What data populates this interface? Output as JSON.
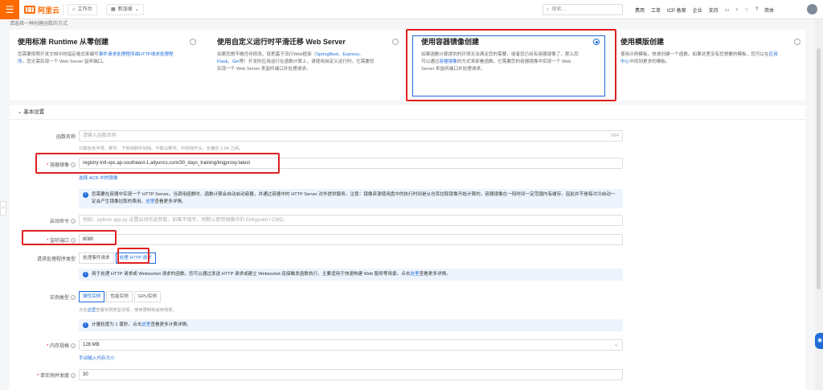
{
  "topbar": {
    "menu_icon": "menu-icon",
    "logo_text": "阿里云",
    "workbench": "工作台",
    "region": "新加坡",
    "search_placeholder": "搜索...",
    "links": [
      "费用",
      "工单",
      "ICP 备案",
      "企业",
      "支持",
      "简体"
    ]
  },
  "crop_text": "请选择一种创建函数的方式",
  "cards": [
    {
      "title": "使用标准 Runtime 从零创建",
      "desc_pre": "您需要按照开发文档中的指定格式来编写",
      "desc_link": "事件请求处理程序或HTTP请求处理程序",
      "desc_post": "。您无需实现一个 Web Server 监听端口。",
      "selected": false
    },
    {
      "title": "使用自定义运行时平滑迁移 Web Server",
      "desc_pre": "如果您想不做任何修改，就把基于流行Web框架（",
      "desc_link": "SpringBoot、Express、Flask、Gin",
      "desc_post": "等）开发的应用运行在函数计算上，请使用自定义运行时。它需要您实现一个 Web Server 来监听端口并处理请求。",
      "selected": false
    },
    {
      "title": "使用容器镜像创建",
      "desc_pre": "如果函数计算提供的环境无法满足您的需要，或者您已经有容器镜像了，那么您可以通过",
      "desc_link": "容器镜像",
      "desc_post": "的方式来部署函数。它需要您的容器镜像中实现一个 Web Server 来监听端口并处理请求。",
      "selected": true
    },
    {
      "title": "使用模版创建",
      "desc_pre": "使用示例模板，快速创建一个函数。如果这里没有您想要的模板，您可以在",
      "desc_link": "应用中心",
      "desc_post": "中找到更多的模板。",
      "selected": false
    }
  ],
  "form": {
    "section_title": "基本设置",
    "function_name": {
      "label": "函数名称",
      "placeholder": "请输入函数名称",
      "counter": "0/64",
      "hint": "只能包含字母、数字、下划线和中划线。不能以数字、中划线开头。长度在 1-64 之间。"
    },
    "image": {
      "label": "容器镜像",
      "value": "registry-intl-vpc.ap-southeast-1.aliyuncs.com/30_days_training/imgproxy:latest",
      "link": "选择 ACR 中的镜像"
    },
    "image_info": {
      "text": "您需要在容器中实现一个 HTTP Server。当调用函数时，函数计算会自动启动容器，并通过容器中的 HTTP Server 对外提供服务。注意：镜像资源使用盘中的执行时间是从仓库拉取镜像开始计算的，容器镜像在一段时间一定范围内有缓存，因此并不是每次冷启动一定会产生镜像拉取的费用。",
      "link": "这里",
      "post": "查看更多详情。"
    },
    "startup": {
      "label": "启动命令",
      "placeholder": "例如：python app.py 设置启动可选参数，如果不填写，则默认使用镜像中的 Entrypoint / CMD。"
    },
    "port": {
      "label": "监听端口",
      "value": "8080"
    },
    "handler_type": {
      "label": "请求处理程序类型",
      "options": [
        "处理事件请求",
        "处理 HTTP 请求"
      ],
      "active": 1
    },
    "handler_info": {
      "text": "用于处理 HTTP 请求或 Websocket 请求的函数。您可以通过发送 HTTP 请求或建立 Websocket 连接触发函数执行，主要适用于快速构建 Web 服务等场景。点击",
      "link": "这里",
      "post": "查看更多详情。"
    },
    "instance_type": {
      "label": "实例类型",
      "options": [
        "弹性实例",
        "性能实例",
        "GPU实例"
      ],
      "active": 0,
      "hint_pre": "点击",
      "hint_link": "这里",
      "hint_post": "查看实例类型详情，使用限制和适用场景。"
    },
    "billing_info": {
      "text": "计量粒度为 1 毫秒。点击",
      "link": "这里",
      "post": "查看更多计费详情。"
    },
    "memory": {
      "label": "内存规格",
      "value": "128 MB",
      "link": "手动输入内存大小"
    },
    "concurrency": {
      "label": "单实例并发度",
      "value": "30"
    }
  }
}
